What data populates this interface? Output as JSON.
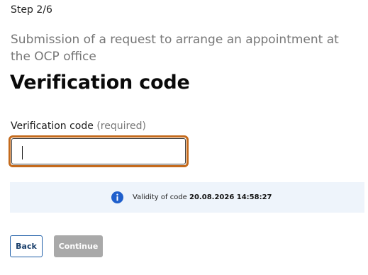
{
  "step": "Step 2/6",
  "subtitle": "Submission of a request to arrange an appointment at the OCP office",
  "title": "Verification code",
  "field": {
    "label": "Verification code",
    "required_note": "(required)",
    "value": "",
    "placeholder": ""
  },
  "info": {
    "icon": "info-icon",
    "label": "Validity of code ",
    "value": "20.08.2026 14:58:27"
  },
  "buttons": {
    "back_label": "Back",
    "continue_label": "Continue"
  },
  "colors": {
    "focus_outline": "#c46a1c",
    "info_background": "#eef4fb",
    "info_icon": "#1f5fcc",
    "back_border": "#1f5fa8",
    "continue_disabled": "#a9a9a9"
  }
}
